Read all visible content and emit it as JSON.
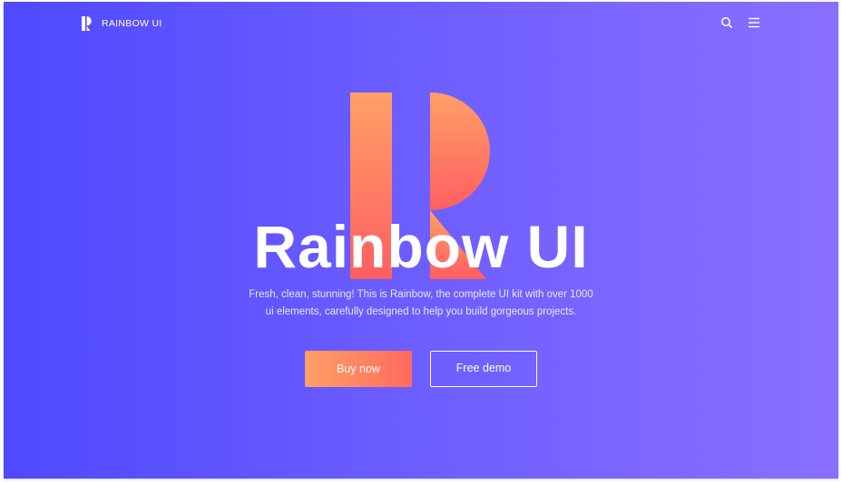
{
  "header": {
    "brand_name": "RAINBOW UI",
    "logo_icon": "rainbow-r-logo",
    "search_icon": "search-icon",
    "menu_icon": "hamburger-menu-icon"
  },
  "hero": {
    "title": "Rainbow UI",
    "description_line_1": "Fresh, clean, stunning! This is Rainbow, the complete UI kit with over 1000",
    "description_line_2": "ui elements, carefully designed to help you build gorgeous projects.",
    "buy_button_label": "Buy now",
    "demo_button_label": "Free demo"
  },
  "colors": {
    "background_start": "#4f49ff",
    "background_end": "#8a6fff",
    "accent_start": "#ffa066",
    "accent_end": "#ff6a5e",
    "text": "#ffffff"
  }
}
